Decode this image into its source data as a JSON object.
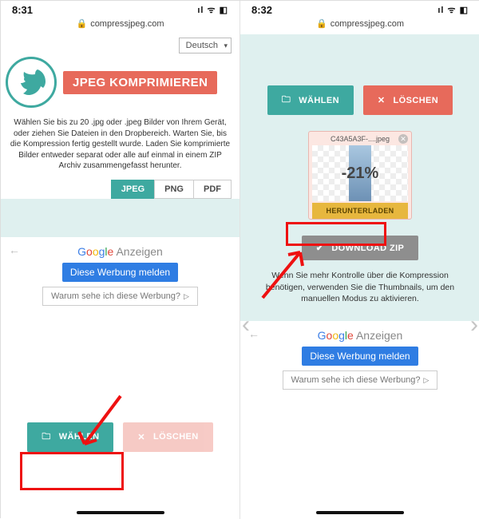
{
  "left": {
    "time": "8:31",
    "signal": "••ıl  ᯤ  ▢",
    "url": "compressjpeg.com",
    "lang": "Deutsch",
    "title": "JPEG KOMPRIMIEREN",
    "intro": "Wählen Sie bis zu 20 .jpg oder .jpeg Bilder von Ihrem Gerät, oder ziehen Sie Dateien in den Dropbereich. Warten Sie, bis die Kompression fertig gestellt wurde. Laden Sie komprimierte Bilder entweder separat oder alle auf einmal in einem ZIP Archiv zusammengefasst herunter.",
    "tabs": {
      "jpeg": "JPEG",
      "png": "PNG",
      "pdf": "PDF"
    },
    "ads": {
      "heading_brand": [
        "G",
        "o",
        "o",
        "g",
        "l",
        "e"
      ],
      "heading_word": " Anzeigen",
      "report": "Diese Werbung melden",
      "why": "Warum sehe ich diese Werbung?"
    },
    "buttons": {
      "choose": "WÄHLEN",
      "clear": "LÖSCHEN"
    }
  },
  "right": {
    "time": "8:32",
    "url": "compressjpeg.com",
    "buttons": {
      "choose": "WÄHLEN",
      "clear": "LÖSCHEN",
      "zip": "DOWNLOAD ZIP"
    },
    "thumb": {
      "file": "C43A5A3F-....jpeg",
      "pct": "-21%",
      "download": "HERUNTERLADEN"
    },
    "note": "Wenn Sie mehr Kontrolle über die Kompression benötigen, verwenden Sie die Thumbnails, um den manuellen Modus zu aktivieren.",
    "ads": {
      "heading_word": " Anzeigen",
      "report": "Diese Werbung melden",
      "why": "Warum sehe ich diese Werbung?"
    }
  }
}
